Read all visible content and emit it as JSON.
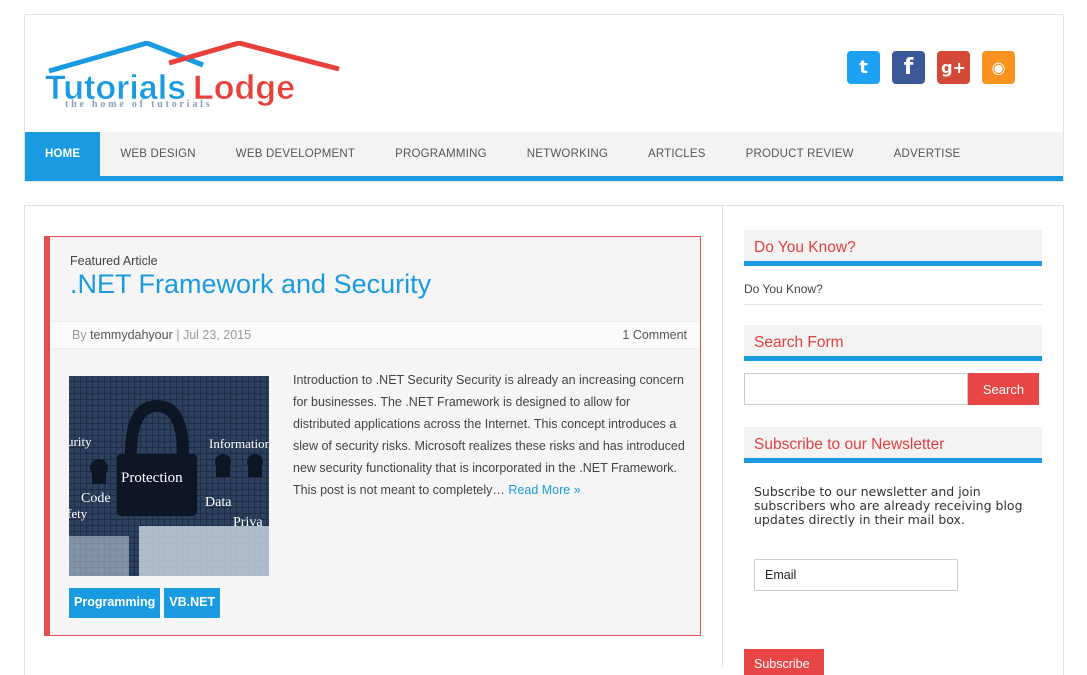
{
  "brand": {
    "logo_main": "TutorialsLodge",
    "logo_tagline": "the home of tutorials",
    "colors": {
      "accent": "#1a9ae0",
      "red": "#e84545",
      "logo_red": "#e8403a"
    }
  },
  "social": [
    {
      "name": "twitter-icon",
      "glyph": "t"
    },
    {
      "name": "facebook-icon",
      "glyph": "f"
    },
    {
      "name": "google-plus-icon",
      "glyph": "g+"
    },
    {
      "name": "rss-icon",
      "glyph": "◉"
    }
  ],
  "nav": {
    "items": [
      "HOME",
      "WEB DESIGN",
      "WEB DEVELOPMENT",
      "PROGRAMMING",
      "NETWORKING",
      "ARTICLES",
      "PRODUCT REVIEW",
      "ADVERTISE"
    ],
    "active": "HOME"
  },
  "featured": {
    "label": "Featured Article",
    "title": ".NET Framework and Security",
    "by": "By",
    "author": "temmydahyour",
    "date": "Jul 23, 2015",
    "comments": "1 Comment",
    "excerpt": "Introduction to .NET Security Security is already an increasing concern for businesses. The .NET Framework is designed to allow for distributed applications across the Internet. This concept introduces a slew of security risks. Microsoft realizes these risks and has introduced new security functionality that is incorporated in the .NET Framework. This post is not meant to completely…",
    "read_more": "Read More »",
    "tags": [
      "Programming",
      "VB.NET"
    ],
    "image_words": {
      "protection": "Protection",
      "information": "Information",
      "code": "Code",
      "data": "Data",
      "urity": "urity",
      "fety": "fety",
      "priva": "Priva"
    }
  },
  "sidebar": {
    "do_you_know": {
      "title": "Do You Know?",
      "text": "Do You Know?"
    },
    "search": {
      "title": "Search Form",
      "placeholder": "",
      "button": "Search"
    },
    "newsletter": {
      "title": "Subscribe to our Newsletter",
      "text": "Subscribe to our newsletter and join subscribers who are already receiving blog updates directly in their mail box.",
      "email_placeholder": "Email",
      "button": "Subscribe"
    }
  }
}
